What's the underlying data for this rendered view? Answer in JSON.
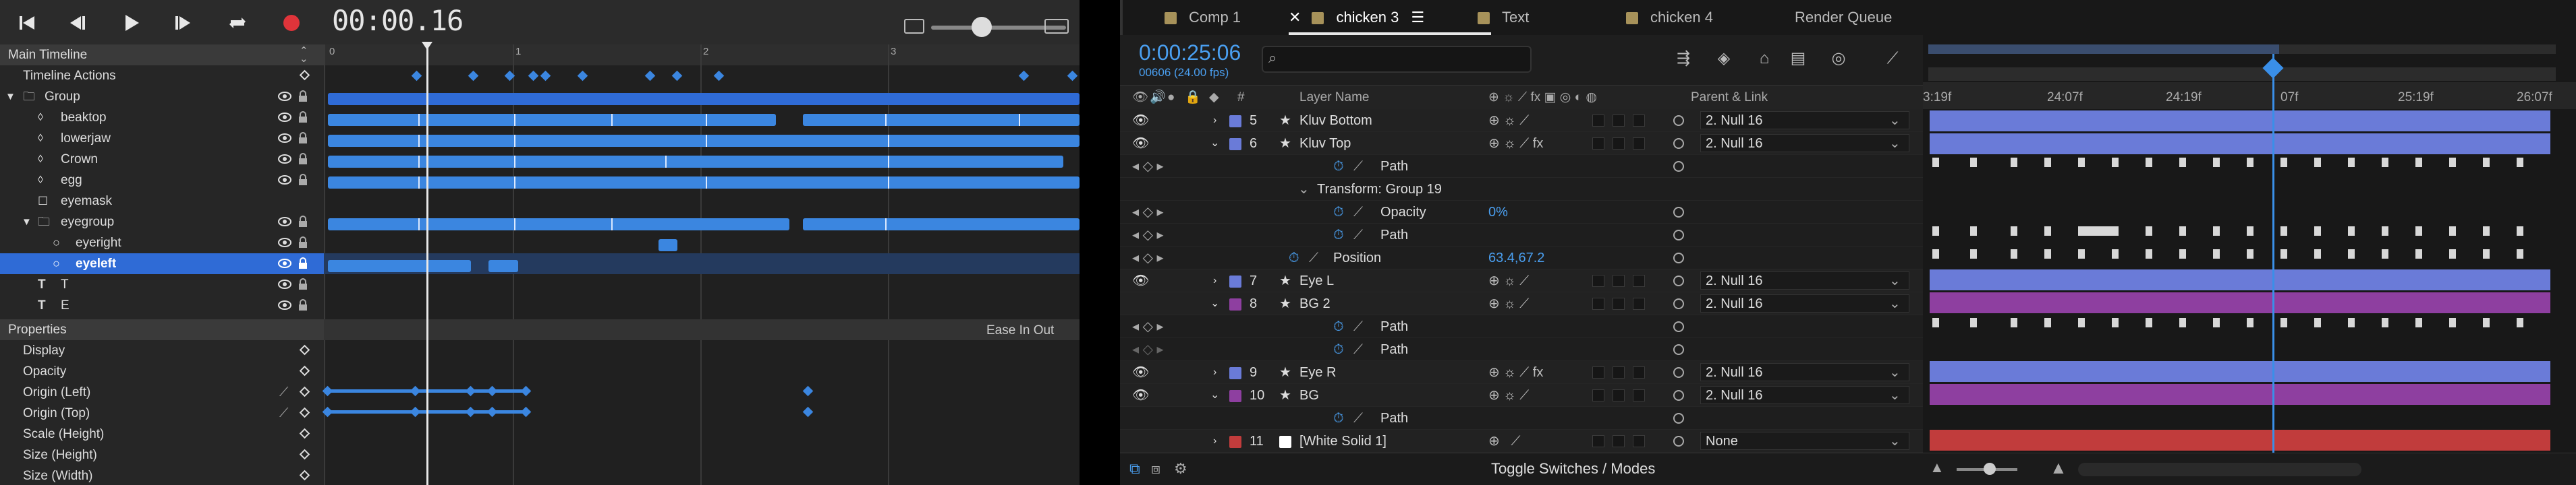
{
  "left_app": {
    "timecode": "00:00.16",
    "ruler_numbers": [
      "0",
      "1",
      "2",
      "3"
    ],
    "rows": [
      {
        "label": "Main Timeline",
        "type": "header"
      },
      {
        "label": "Timeline Actions",
        "type": "plain"
      },
      {
        "label": "Group",
        "type": "group"
      },
      {
        "label": "beaktop",
        "type": "shape"
      },
      {
        "label": "lowerjaw",
        "type": "shape"
      },
      {
        "label": "Crown",
        "type": "shape"
      },
      {
        "label": "egg",
        "type": "shape"
      },
      {
        "label": "eyemask",
        "type": "mask"
      },
      {
        "label": "eyegroup",
        "type": "group"
      },
      {
        "label": "eyeright",
        "type": "circle"
      },
      {
        "label": "eyeleft",
        "type": "circle"
      },
      {
        "label": "T",
        "type": "text"
      },
      {
        "label": "E",
        "type": "text"
      }
    ],
    "properties_header": "Properties",
    "ease": "Ease In Out",
    "properties": [
      "Display",
      "Opacity",
      "Origin (Left)",
      "Origin (Top)",
      "Scale (Height)",
      "Size (Height)",
      "Size (Width)"
    ]
  },
  "right_app": {
    "tabs": [
      "Comp 1",
      "chicken 3",
      "Text",
      "chicken 4",
      "Render Queue"
    ],
    "active_tab": "chicken 3",
    "timecode": "0:00:25:06",
    "fps": "00606 (24.00 fps)",
    "search_placeholder": "",
    "columns": {
      "num": "#",
      "layer_name": "Layer Name",
      "parent": "Parent & Link"
    },
    "rows": [
      {
        "kind": "layer",
        "num": "5",
        "name": "Kluv Bottom",
        "color": "#6a7bd8",
        "parent": "2. Null 16",
        "expanded": false
      },
      {
        "kind": "layer",
        "num": "6",
        "name": "Kluv Top",
        "color": "#6a7bd8",
        "parent": "2. Null 16",
        "expanded": true
      },
      {
        "kind": "prop",
        "name": "Path",
        "value": ""
      },
      {
        "kind": "group",
        "name": "Transform: Group 19"
      },
      {
        "kind": "prop",
        "name": "Opacity",
        "value": "0%"
      },
      {
        "kind": "prop",
        "name": "Path",
        "value": ""
      },
      {
        "kind": "prop",
        "name": "Position",
        "value": "63.4,67.2"
      },
      {
        "kind": "layer",
        "num": "7",
        "name": "Eye L",
        "color": "#6a7bd8",
        "parent": "2. Null 16",
        "expanded": false
      },
      {
        "kind": "layer",
        "num": "8",
        "name": "BG 2",
        "color": "#8e3fa0",
        "parent": "2. Null 16",
        "expanded": true
      },
      {
        "kind": "prop",
        "name": "Path",
        "value": ""
      },
      {
        "kind": "prop",
        "name": "Path",
        "value": ""
      },
      {
        "kind": "layer",
        "num": "9",
        "name": "Eye R",
        "color": "#6a7bd8",
        "parent": "2. Null 16",
        "expanded": false
      },
      {
        "kind": "layer",
        "num": "10",
        "name": "BG",
        "color": "#8e3fa0",
        "parent": "2. Null 16",
        "expanded": true
      },
      {
        "kind": "prop",
        "name": "Path",
        "value": ""
      },
      {
        "kind": "layer",
        "num": "11",
        "name": "[White Solid 1]",
        "color": "#c13c3c",
        "parent": "None",
        "expanded": false
      }
    ],
    "ruler": [
      "3:19f",
      "24:07f",
      "24:19f",
      "07f",
      "25:19f",
      "26:07f"
    ],
    "toggle_label": "Toggle Switches / Modes"
  }
}
